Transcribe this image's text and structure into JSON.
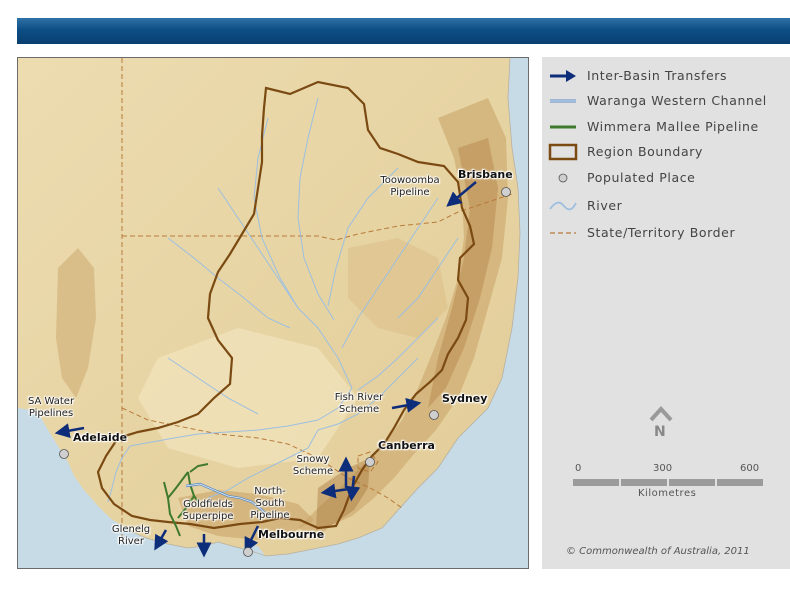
{
  "legend": [
    {
      "key": "transfers",
      "label": "Inter-Basin Transfers"
    },
    {
      "key": "waranga",
      "label": "Waranga Western Channel"
    },
    {
      "key": "wimmera",
      "label": "Wimmera Mallee Pipeline"
    },
    {
      "key": "region",
      "label": "Region Boundary"
    },
    {
      "key": "place",
      "label": "Populated Place"
    },
    {
      "key": "river",
      "label": "River"
    },
    {
      "key": "border",
      "label": "State/Territory Border"
    }
  ],
  "cities": {
    "brisbane": "Brisbane",
    "sydney": "Sydney",
    "canberra": "Canberra",
    "adelaide": "Adelaide",
    "melbourne": "Melbourne"
  },
  "transfers": {
    "toowoomba": "Toowoomba Pipeline",
    "fish_river": "Fish River Scheme",
    "sa_water": "SA Water Pipelines",
    "snowy": "Snowy Scheme",
    "goldfields": "Goldfields Superpipe",
    "north_south": "North-South Pipeline",
    "glenelg": "Glenelg River"
  },
  "north_arrow": {
    "letter": "N"
  },
  "scale_bar": {
    "ticks": [
      "0",
      "300",
      "600"
    ],
    "units": "Kilometres"
  },
  "copyright": "© Commonwealth of Australia, 2011",
  "colors": {
    "transfer_arrow": "#0d2d7a",
    "waranga": "#5b8cc4",
    "wimmera": "#3f7a2c",
    "region_boundary": "#7a4a12",
    "river": "#9cbfe0",
    "border": "#b87a3a",
    "sea": "#c6dbe6",
    "land": "#e6d3a3",
    "highland": "#c8a56a",
    "banner": "#0d4e86"
  }
}
